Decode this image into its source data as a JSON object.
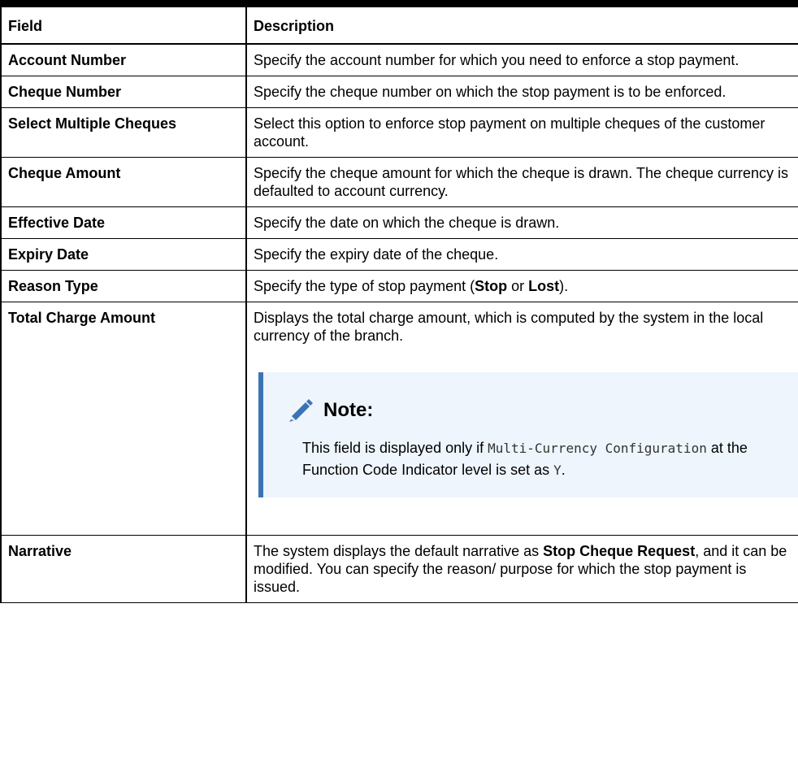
{
  "table": {
    "headers": {
      "field": "Field",
      "description": "Description"
    },
    "rows": [
      {
        "field": "Account Number",
        "description": "Specify the account number for which you need to enforce a stop payment."
      },
      {
        "field": "Cheque Number",
        "description": "Specify the cheque number on which the stop payment is to be enforced."
      },
      {
        "field": "Select Multiple Cheques",
        "description": "Select this option to enforce stop payment on multiple cheques of the customer account."
      },
      {
        "field": "Cheque Amount",
        "description": "Specify the cheque amount for which the cheque is drawn. The cheque currency is defaulted to account currency."
      },
      {
        "field": "Effective Date",
        "description": "Specify the date on which the cheque is drawn."
      },
      {
        "field": "Expiry Date",
        "description": "Specify the expiry date of the cheque."
      },
      {
        "field": "Reason Type",
        "description_pre": "Specify the type of stop payment (",
        "description_b1": "Stop",
        "description_mid": " or ",
        "description_b2": "Lost",
        "description_post": ")."
      },
      {
        "field": "Total Charge Amount",
        "description": "Displays the total charge amount, which is computed by the system in the local currency of the branch."
      },
      {
        "field": "Narrative",
        "description_pre": "The system displays the default narrative as ",
        "description_b1": "Stop Cheque Request",
        "description_post": ", and it can be modified. You can specify the reason/ purpose for which the stop payment is issued."
      }
    ]
  },
  "note": {
    "icon": "pencil-icon",
    "title": "Note:",
    "text_1": "This field is displayed only if ",
    "code_1": "Multi-Currency Configuration",
    "text_2": " at the Function Code Indicator level is set as ",
    "code_2": "Y",
    "text_3": ".",
    "accent_color": "#3a74b5",
    "background_color": "#eef5fc"
  }
}
